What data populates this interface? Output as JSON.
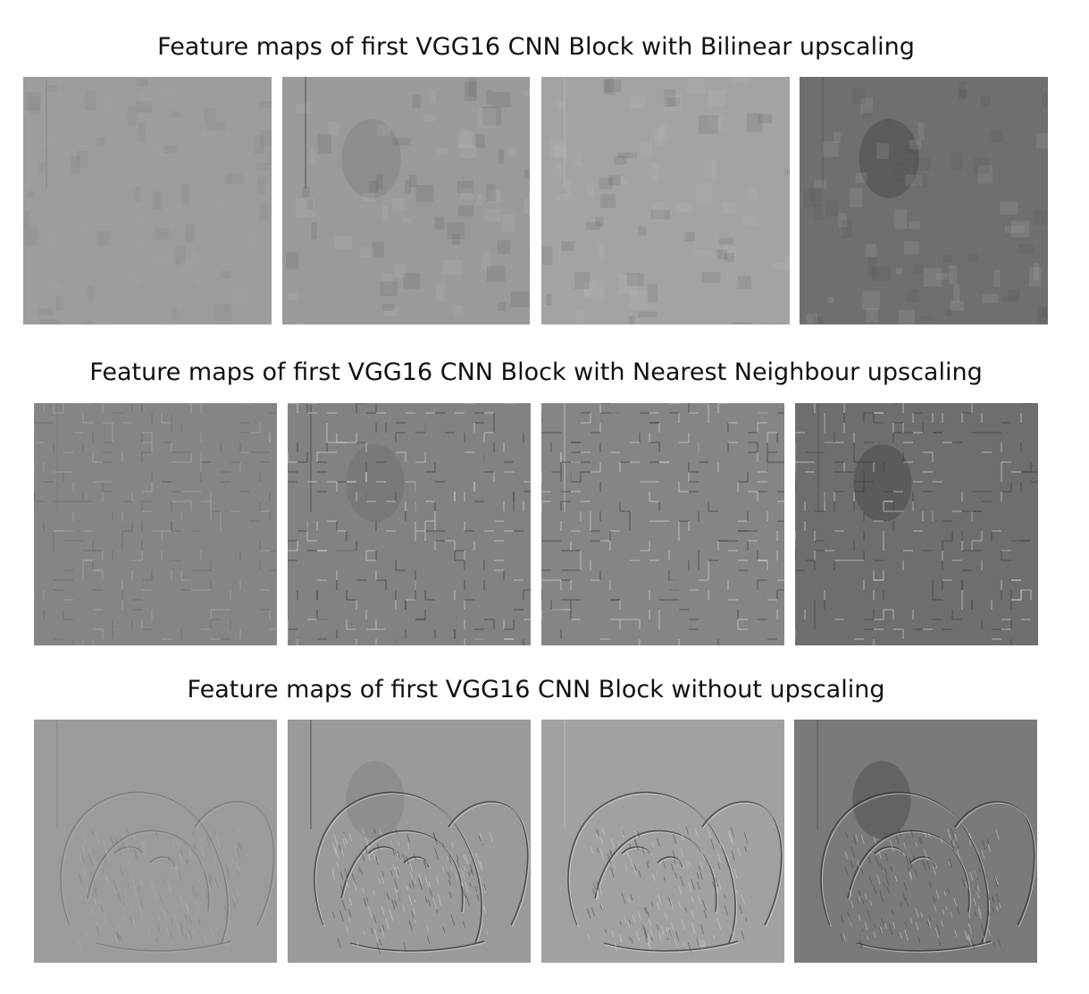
{
  "figure": {
    "rows": [
      {
        "title": "Feature maps of first VGG16 CNN Block with Bilinear upscaling",
        "maps": [
          {
            "tone": "#9c9c9c",
            "name": "bilinear-map-1"
          },
          {
            "tone": "#9a9a9a",
            "name": "bilinear-map-2"
          },
          {
            "tone": "#a3a3a3",
            "name": "bilinear-map-3"
          },
          {
            "tone": "#6f6f6f",
            "name": "bilinear-map-4"
          }
        ]
      },
      {
        "title": "Feature maps of first VGG16 CNN Block with Nearest Neighbour upscaling",
        "maps": [
          {
            "tone": "#858585",
            "name": "nearest-map-1"
          },
          {
            "tone": "#828282",
            "name": "nearest-map-2"
          },
          {
            "tone": "#858585",
            "name": "nearest-map-3"
          },
          {
            "tone": "#6e6e6e",
            "name": "nearest-map-4"
          }
        ]
      },
      {
        "title": "Feature maps of first VGG16 CNN Block without upscaling",
        "maps": [
          {
            "tone": "#9b9b9b",
            "name": "no-upscale-map-1"
          },
          {
            "tone": "#9a9a9a",
            "name": "no-upscale-map-2"
          },
          {
            "tone": "#a1a1a1",
            "name": "no-upscale-map-3"
          },
          {
            "tone": "#7a7a7a",
            "name": "no-upscale-map-4"
          }
        ]
      }
    ]
  }
}
